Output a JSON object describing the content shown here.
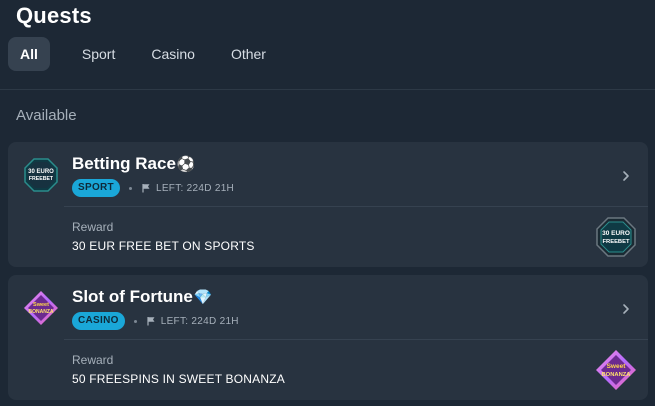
{
  "page": {
    "title": "Quests"
  },
  "tabs": [
    {
      "label": "All",
      "active": true
    },
    {
      "label": "Sport",
      "active": false
    },
    {
      "label": "Casino",
      "active": false
    },
    {
      "label": "Other",
      "active": false
    }
  ],
  "section": {
    "label": "Available"
  },
  "quests": [
    {
      "name": "Betting Race",
      "emoji": "⚽",
      "category": "SPORT",
      "time_left": "LEFT: 224D 21H",
      "reward_label": "Reward",
      "reward": "30 EUR FREE BET ON SPORTS",
      "icon": "freebet-badge-icon",
      "icon_text_top": "30 EURO",
      "icon_text_bottom": "FREEBET"
    },
    {
      "name": "Slot of Fortune",
      "emoji": "💎",
      "category": "CASINO",
      "time_left": "LEFT: 224D 21H",
      "reward_label": "Reward",
      "reward": "50 FREESPINS IN SWEET BONANZA",
      "icon": "sweet-bonanza-icon",
      "icon_text_top": "Sweet",
      "icon_text_bottom": "BONANZA"
    }
  ],
  "colors": {
    "background": "#1d2835",
    "card": "#283340",
    "badge": "#1aa7d8",
    "tab_active": "#364250"
  }
}
